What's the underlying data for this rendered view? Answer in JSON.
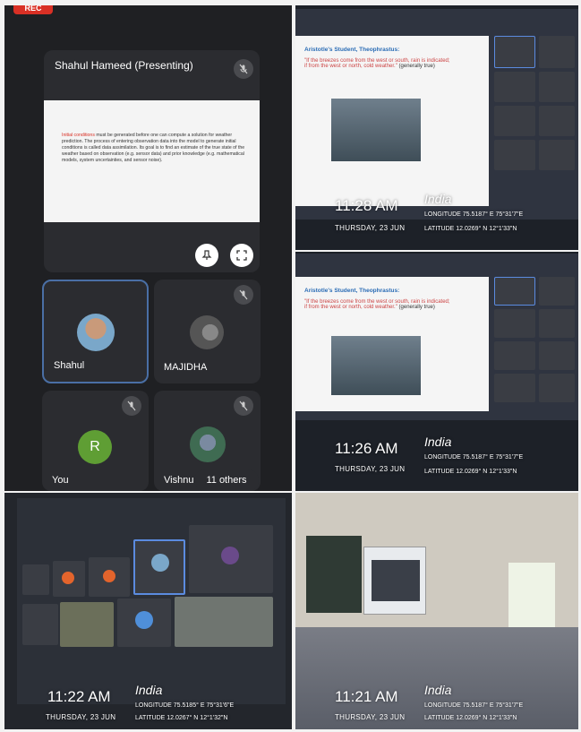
{
  "meet": {
    "rec_label": "REC",
    "presenter_title": "Shahul Hameed (Presenting)",
    "slide": {
      "highlight": "Initial conditions",
      "body": " must be generated before one can compute a solution for weather prediction. The process of entering observation data into the model to generate initial conditions is called data assimilation. Its goal is to find an estimate of the true state of the weather based on observation (e.g. sensor data) and prior knowledge (e.g. mathematical models, system uncertainties, and sensor noise)."
    },
    "participants": [
      {
        "name": "Shahul"
      },
      {
        "name": "MAJIDHA"
      },
      {
        "name": "You",
        "initial": "R"
      },
      {
        "name": "Vishnu"
      }
    ],
    "others_label": "11 others",
    "colors": {
      "bg": "#1f2023",
      "tile": "#2b2c30",
      "rec": "#d93025",
      "avatar_you": "#5f9e34"
    }
  },
  "photos": [
    {
      "time": "11:28 AM",
      "date": "THURSDAY, 23 JUN",
      "location": "India",
      "longitude": "LONGITUDE 75.5187° E  75°31'7\"E",
      "latitude": "LATITUDE  12.0269° N  12°1'33\"N",
      "slide_title": "Aristotle's Student, Theophrastus:",
      "slide_quote": "\"If the breezes come from the west or south, rain is indicated; if from the west or north, cold weather.\"",
      "slide_note": "(generally true)"
    },
    {
      "time": "11:26 AM",
      "date": "THURSDAY, 23 JUN",
      "location": "India",
      "longitude": "LONGITUDE 75.5187° E  75°31'7\"E",
      "latitude": "LATITUDE  12.0269° N  12°1'33\"N",
      "slide_title": "Aristotle's Student, Theophrastus:",
      "slide_quote": "\"If the breezes come from the west or south, rain is indicated; if from the west or north, cold weather.\"",
      "slide_note": "(generally true)"
    },
    {
      "time": "11:22 AM",
      "date": "THURSDAY, 23 JUN",
      "location": "India",
      "longitude": "LONGITUDE 75.5185° E  75°31'6\"E",
      "latitude": "LATITUDE  12.0267° N  12°1'32\"N"
    },
    {
      "time": "11:21 AM",
      "date": "THURSDAY, 23 JUN",
      "location": "India",
      "longitude": "LONGITUDE 75.5187° E  75°31'7\"E",
      "latitude": "LATITUDE  12.0269° N  12°1'33\"N"
    }
  ]
}
